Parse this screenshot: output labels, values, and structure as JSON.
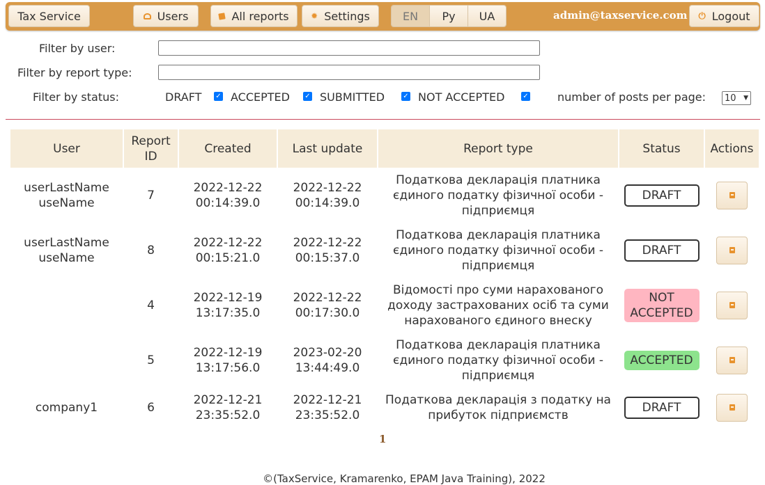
{
  "nav": {
    "brand": "Tax Service",
    "users": "Users",
    "all_reports": "All reports",
    "settings": "Settings",
    "languages": [
      "EN",
      "Ру",
      "UA"
    ],
    "active_language": "EN",
    "email": "admin@taxservice.com",
    "logout": "Logout",
    "icons": {
      "users": "user-icon",
      "all_reports": "report-icon",
      "settings": "gear-icon",
      "logout": "power-icon"
    },
    "colors": {
      "bar": "#d99a48",
      "icon": "#e8932e"
    }
  },
  "filters": {
    "user_label": "Filter by user:",
    "user_value": "",
    "type_label": "Filter by report type:",
    "type_value": "",
    "status_label": "Filter by status:",
    "statuses": [
      {
        "label": "DRAFT",
        "checked": true
      },
      {
        "label": "ACCEPTED",
        "checked": true
      },
      {
        "label": "SUBMITTED",
        "checked": true
      },
      {
        "label": "NOT ACCEPTED",
        "checked": true
      }
    ],
    "per_page_label": "number of posts per page:",
    "per_page_value": "10"
  },
  "table": {
    "headers": {
      "user": "User",
      "report_id_1": "Report",
      "report_id_2": "ID",
      "created": "Created",
      "last_update": "Last update",
      "report_type": "Report type",
      "status": "Status",
      "actions": "Actions"
    },
    "rows": [
      {
        "user_1": "userLastName",
        "user_2": "useName",
        "id": "7",
        "created_1": "2022-12-22",
        "created_2": "00:14:39.0",
        "updated_1": "2022-12-22",
        "updated_2": "00:14:39.0",
        "type_1": "Податкова декларація платника",
        "type_2": "єдиного податку фізичної особи -",
        "type_3": "підприємця",
        "status": "DRAFT"
      },
      {
        "user_1": "userLastName",
        "user_2": "useName",
        "id": "8",
        "created_1": "2022-12-22",
        "created_2": "00:15:21.0",
        "updated_1": "2022-12-22",
        "updated_2": "00:15:37.0",
        "type_1": "Податкова декларація платника",
        "type_2": "єдиного податку фізичної особи -",
        "type_3": "підприємця",
        "status": "DRAFT"
      },
      {
        "user_1": "",
        "user_2": "",
        "id": "4",
        "created_1": "2022-12-19",
        "created_2": "13:17:35.0",
        "updated_1": "2022-12-22",
        "updated_2": "00:17:30.0",
        "type_1": "Відомості про суми нарахованого",
        "type_2": "доходу застрахованих осіб та суми",
        "type_3": "нарахованого єдиного внеску",
        "status_1": "NOT",
        "status_2": "ACCEPTED"
      },
      {
        "user_1": "",
        "user_2": "",
        "id": "5",
        "created_1": "2022-12-19",
        "created_2": "13:17:56.0",
        "updated_1": "2023-02-20",
        "updated_2": "13:44:49.0",
        "type_1": "Податкова декларація платника",
        "type_2": "єдиного податку фізичної особи -",
        "type_3": "підприємця",
        "status": "ACCEPTED"
      },
      {
        "user_1": "company1",
        "user_2": "",
        "id": "6",
        "created_1": "2022-12-21",
        "created_2": "23:35:52.0",
        "updated_1": "2022-12-21",
        "updated_2": "23:35:52.0",
        "type_1": "Податкова декларація з податку на",
        "type_2": "прибуток підприємств",
        "type_3": "",
        "status": "DRAFT"
      }
    ],
    "status_colors": {
      "DRAFT": "#ffffff",
      "NOT ACCEPTED": "#ffb6c1",
      "ACCEPTED": "#8de38d"
    },
    "action_icon": "document-icon"
  },
  "pagination": {
    "current": "1"
  },
  "footer": "©(TaxService, Kramarenko, EPAM Java Training), 2022"
}
